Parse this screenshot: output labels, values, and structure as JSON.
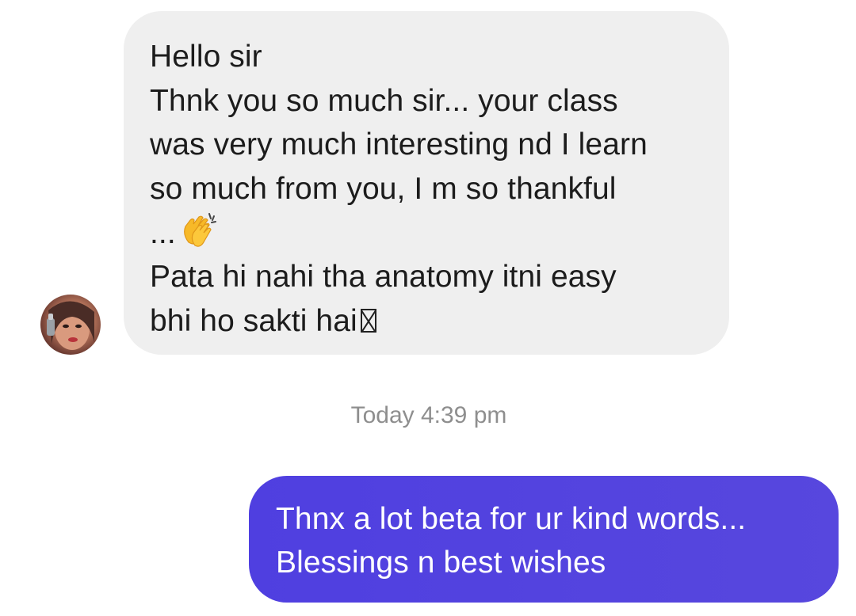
{
  "conversation": {
    "incoming_message": {
      "lines": [
        "Hello sir",
        "Thnk you so much sir... your class",
        "was very much interesting nd I learn",
        "so much from you, I m so thankful",
        "...",
        "Pata hi nahi tha anatomy itni easy",
        "bhi ho sakti hai"
      ],
      "emoji_icon": "clapping-hands-icon",
      "trailing_glyph_icon": "missing-glyph-box-icon"
    },
    "timestamp": "Today 4:39 pm",
    "outgoing_message": {
      "lines": [
        "Thnx a lot beta for ur kind words...",
        "Blessings n best wishes"
      ],
      "gradient_start": "#4f3fe0",
      "gradient_end": "#5747de"
    },
    "avatar_icon": "user-avatar-icon",
    "incoming_bubble_color": "#efefef",
    "timestamp_color": "#8e8e8e"
  }
}
